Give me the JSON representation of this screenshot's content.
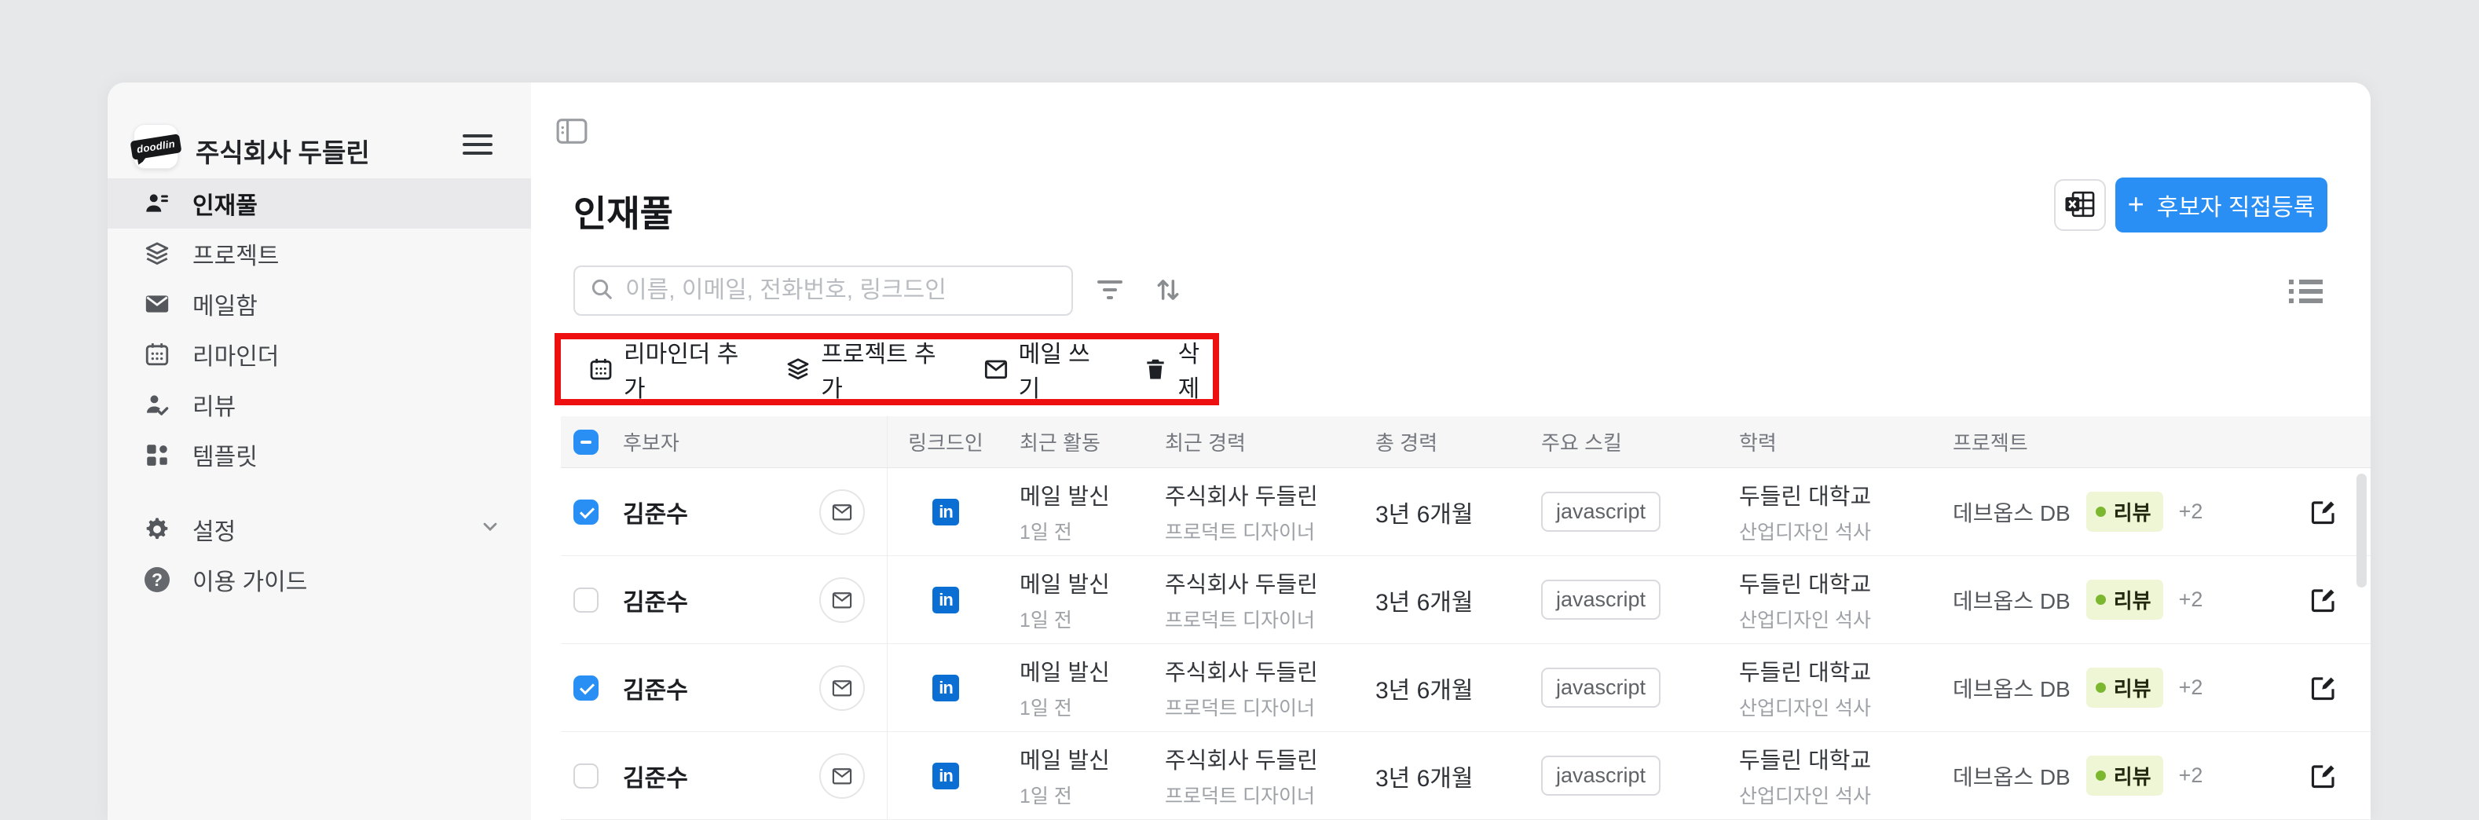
{
  "colors": {
    "page_bg": "#e7e8ea",
    "sidebar_bg": "#f7f7f8",
    "active_item_bg": "#e9e9eb",
    "accent_blue": "#2a8ff5",
    "linkedin_blue": "#0a6ed3",
    "annotation_red": "#ee1010",
    "review_badge_bg": "#eff6d6",
    "review_badge_dot": "#7cb82f"
  },
  "sidebar": {
    "logo_text": "doodlin",
    "company_name": "주식회사 두들린",
    "items": [
      {
        "label": "인재풀",
        "icon": "talent-pool-icon",
        "active": true
      },
      {
        "label": "프로젝트",
        "icon": "layers-icon",
        "active": false
      },
      {
        "label": "메일함",
        "icon": "mail-icon",
        "active": false
      },
      {
        "label": "리마인더",
        "icon": "calendar-icon",
        "active": false
      },
      {
        "label": "리뷰",
        "icon": "person-check-icon",
        "active": false
      },
      {
        "label": "템플릿",
        "icon": "grid-icon",
        "active": false
      }
    ],
    "footer_items": [
      {
        "label": "설정",
        "icon": "gear-icon",
        "has_chevron": true
      },
      {
        "label": "이용 가이드",
        "icon": "question-circle-icon",
        "has_chevron": false
      }
    ]
  },
  "header": {
    "title": "인재풀",
    "add_button_plus": "+",
    "add_button_label": "후보자 직접등록"
  },
  "search": {
    "placeholder": "이름, 이메일, 전화번호, 링크드인"
  },
  "toolbar": {
    "items": [
      {
        "label": "리마인더 추가",
        "icon": "calendar-icon"
      },
      {
        "label": "프로젝트 추가",
        "icon": "layers-icon"
      },
      {
        "label": "메일 쓰기",
        "icon": "mail-outline-icon"
      },
      {
        "label": "삭제",
        "icon": "trash-icon"
      }
    ]
  },
  "table": {
    "select_all_state": "indeterminate",
    "columns": [
      "후보자",
      "링크드인",
      "최근 활동",
      "최근 경력",
      "총 경력",
      "주요 스킬",
      "학력",
      "프로젝트"
    ],
    "linkedin_glyph": "in",
    "rows": [
      {
        "checked": true,
        "name": "김준수",
        "activity_line1": "메일 발신",
        "activity_line2": "1일 전",
        "career_line1": "주식회사 두들린",
        "career_line2": "프로덕트 디자이너",
        "total_experience": "3년 6개월",
        "skill": "javascript",
        "education_line1": "두들린 대학교",
        "education_line2": "산업디자인 석사",
        "project_name": "데브옵스 DB",
        "project_badge": "리뷰",
        "project_extra": "+2"
      },
      {
        "checked": false,
        "name": "김준수",
        "activity_line1": "메일 발신",
        "activity_line2": "1일 전",
        "career_line1": "주식회사 두들린",
        "career_line2": "프로덕트 디자이너",
        "total_experience": "3년 6개월",
        "skill": "javascript",
        "education_line1": "두들린 대학교",
        "education_line2": "산업디자인 석사",
        "project_name": "데브옵스 DB",
        "project_badge": "리뷰",
        "project_extra": "+2"
      },
      {
        "checked": true,
        "name": "김준수",
        "activity_line1": "메일 발신",
        "activity_line2": "1일 전",
        "career_line1": "주식회사 두들린",
        "career_line2": "프로덕트 디자이너",
        "total_experience": "3년 6개월",
        "skill": "javascript",
        "education_line1": "두들린 대학교",
        "education_line2": "산업디자인 석사",
        "project_name": "데브옵스 DB",
        "project_badge": "리뷰",
        "project_extra": "+2"
      },
      {
        "checked": false,
        "name": "김준수",
        "activity_line1": "메일 발신",
        "activity_line2": "1일 전",
        "career_line1": "주식회사 두들린",
        "career_line2": "프로덕트 디자이너",
        "total_experience": "3년 6개월",
        "skill": "javascript",
        "education_line1": "두들린 대학교",
        "education_line2": "산업디자인 석사",
        "project_name": "데브옵스 DB",
        "project_badge": "리뷰",
        "project_extra": "+2"
      }
    ]
  }
}
